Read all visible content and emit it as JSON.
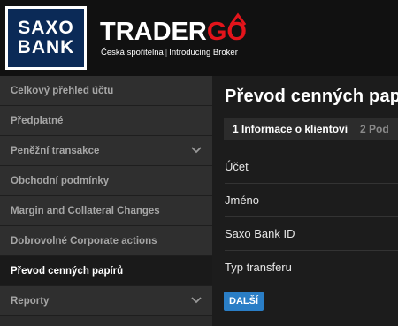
{
  "brand": {
    "saxo_line1": "SAXO",
    "saxo_line2": "BANK",
    "tradergo_trader": "TRADER",
    "tradergo_go": "GO",
    "tradergo_sub_left": "Česká spořitelna",
    "tradergo_sub_sep": "|",
    "tradergo_sub_right": "Introducing Broker"
  },
  "sidebar": {
    "items": [
      {
        "label": "Celkový přehled účtu",
        "active": false,
        "chevron": false
      },
      {
        "label": "Předplatné",
        "active": false,
        "chevron": false
      },
      {
        "label": "Peněžní transakce",
        "active": false,
        "chevron": true
      },
      {
        "label": "Obchodní podmínky",
        "active": false,
        "chevron": false
      },
      {
        "label": "Margin and Collateral Changes",
        "active": false,
        "chevron": false
      },
      {
        "label": "Dobrovolné Corporate actions",
        "active": false,
        "chevron": false
      },
      {
        "label": "Převod cenných papírů",
        "active": true,
        "chevron": false
      },
      {
        "label": "Reporty",
        "active": false,
        "chevron": true
      }
    ]
  },
  "main": {
    "title": "Převod cenných papí",
    "steps": [
      {
        "label": "1 Informace o klientovi",
        "active": true
      },
      {
        "label": "2 Pod",
        "active": false
      }
    ],
    "fields": [
      {
        "label": "Účet"
      },
      {
        "label": "Jméno"
      },
      {
        "label": "Saxo Bank ID"
      },
      {
        "label": "Typ transferu"
      }
    ],
    "next_button": "DALŠÍ"
  },
  "colors": {
    "accent": "#2a7ec6",
    "brand_red": "#e3141b",
    "saxo_navy": "#0b2a57"
  }
}
